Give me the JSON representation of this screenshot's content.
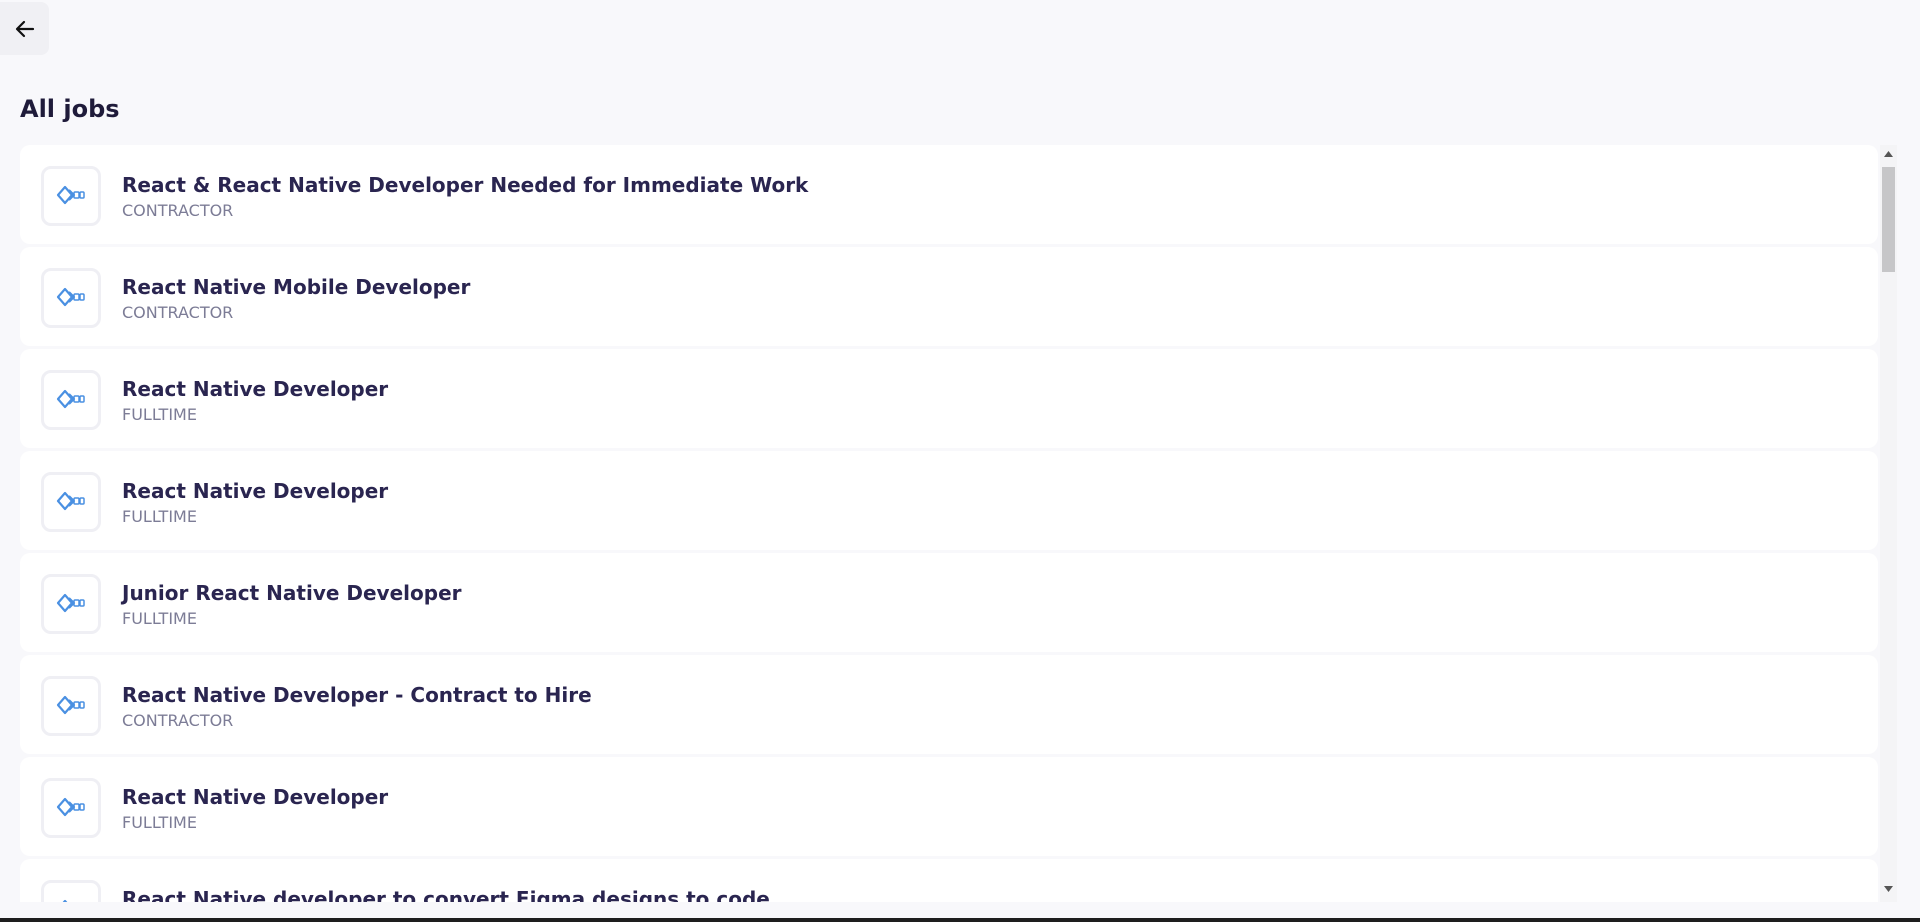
{
  "header": {
    "back_icon": "arrow-left-icon",
    "title": "All jobs"
  },
  "jobs": [
    {
      "title": "React & React Native Developer Needed for Immediate Work",
      "type": "CONTRACTOR",
      "logo_icon": "company-logo-icon"
    },
    {
      "title": "React Native Mobile Developer",
      "type": "CONTRACTOR",
      "logo_icon": "company-logo-icon"
    },
    {
      "title": "React Native Developer",
      "type": "FULLTIME",
      "logo_icon": "company-logo-icon"
    },
    {
      "title": "React Native Developer",
      "type": "FULLTIME",
      "logo_icon": "company-logo-icon"
    },
    {
      "title": "Junior React Native Developer",
      "type": "FULLTIME",
      "logo_icon": "company-logo-icon"
    },
    {
      "title": "React Native Developer - Contract to Hire",
      "type": "CONTRACTOR",
      "logo_icon": "company-logo-icon"
    },
    {
      "title": "React Native Developer",
      "type": "FULLTIME",
      "logo_icon": "company-logo-icon"
    },
    {
      "title": "React Native developer to convert Figma designs to code",
      "type": "",
      "logo_icon": "company-logo-icon"
    }
  ],
  "colors": {
    "background": "#f8f8fb",
    "card": "#ffffff",
    "title_text": "#2a2550",
    "subtitle_text": "#7c7c96",
    "logo_blue": "#4a90e2"
  }
}
